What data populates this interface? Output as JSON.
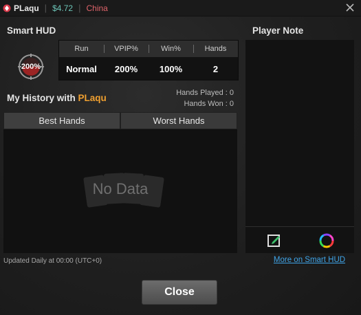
{
  "titlebar": {
    "player_name": "PLaqu",
    "balance": "$4.72",
    "country": "China"
  },
  "smart_hud": {
    "title": "Smart HUD",
    "ring_value": "200%",
    "columns": [
      "Run",
      "VPIP%",
      "Win%",
      "Hands"
    ],
    "values": [
      "Normal",
      "200%",
      "100%",
      "2"
    ]
  },
  "history": {
    "title_prefix": "My History with ",
    "player": "PLaqu",
    "hands_played": "Hands Played : 0",
    "hands_won": "Hands Won : 0",
    "tabs": [
      "Best Hands",
      "Worst Hands"
    ],
    "empty_text": "No Data",
    "updated": "Updated Daily at 00:00 (UTC+0)"
  },
  "player_note": {
    "title": "Player Note",
    "more_link": "More on Smart HUD"
  },
  "close_label": "Close",
  "colors": {
    "accent_orange": "#f0a030",
    "balance_teal": "#6cc3b6",
    "country_red": "#e0646b",
    "link_blue": "#3fa4e8"
  }
}
